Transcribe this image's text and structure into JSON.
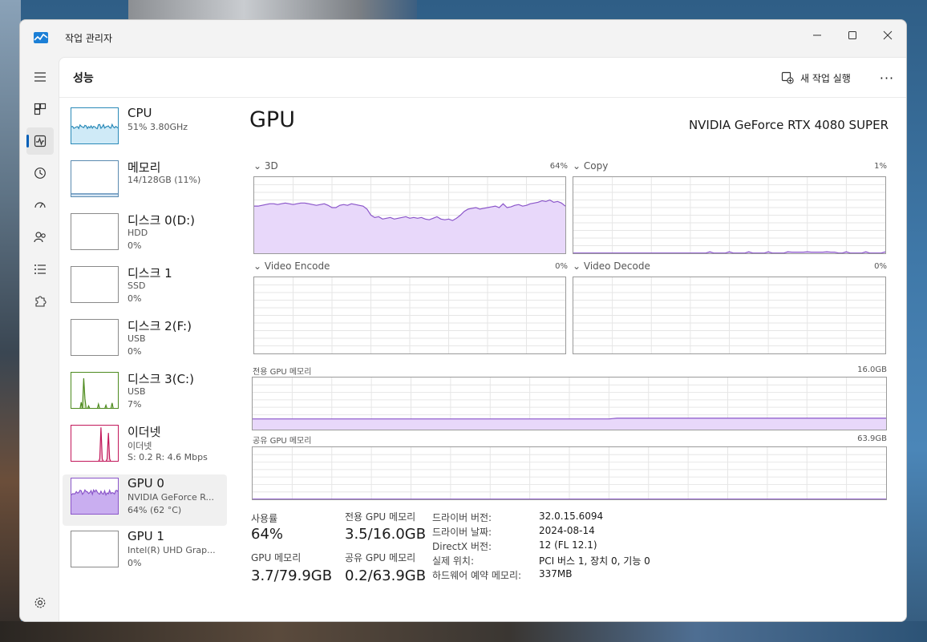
{
  "window": {
    "title": "작업 관리자"
  },
  "header": {
    "title": "성능",
    "new_task_label": "새 작업 실행",
    "more_label": "···"
  },
  "devices": [
    {
      "name": "CPU",
      "sub1": "51% 3.80GHz",
      "sub2": ""
    },
    {
      "name": "메모리",
      "sub1": "14/128GB (11%)",
      "sub2": ""
    },
    {
      "name": "디스크 0(D:)",
      "sub1": "HDD",
      "sub2": "0%"
    },
    {
      "name": "디스크 1",
      "sub1": "SSD",
      "sub2": "0%"
    },
    {
      "name": "디스크 2(F:)",
      "sub1": "USB",
      "sub2": "0%"
    },
    {
      "name": "디스크 3(C:)",
      "sub1": "USB",
      "sub2": "7%"
    },
    {
      "name": "이더넷",
      "sub1": "이더넷",
      "sub2": "S: 0.2  R: 4.6 Mbps"
    },
    {
      "name": "GPU 0",
      "sub1": "NVIDIA GeForce R...",
      "sub2": "64% (62 °C)"
    },
    {
      "name": "GPU 1",
      "sub1": "Intel(R) UHD Grap...",
      "sub2": "0%"
    }
  ],
  "gpu": {
    "title": "GPU",
    "model": "NVIDIA GeForce RTX 4080 SUPER",
    "engines": [
      {
        "label": "3D",
        "value": "64%"
      },
      {
        "label": "Copy",
        "value": "1%"
      },
      {
        "label": "Video Encode",
        "value": "0%"
      },
      {
        "label": "Video Decode",
        "value": "0%"
      }
    ],
    "dedicated_label": "전용 GPU 메모리",
    "dedicated_max": "16.0GB",
    "shared_label": "공유 GPU 메모리",
    "shared_max": "63.9GB"
  },
  "stats": {
    "usage_label": "사용률",
    "usage_value": "64%",
    "dedicated_label": "전용 GPU 메모리",
    "dedicated_value": "3.5/16.0GB",
    "gpu_mem_label": "GPU 메모리",
    "gpu_mem_value": "3.7/79.9GB",
    "shared_label": "공유 GPU 메모리",
    "shared_value": "0.2/63.9GB"
  },
  "props": [
    {
      "label": "드라이버 버전:",
      "value": "32.0.15.6094"
    },
    {
      "label": "드라이버 날짜:",
      "value": "2024-08-14"
    },
    {
      "label": "DirectX 버전:",
      "value": "12 (FL 12.1)"
    },
    {
      "label": "실제 위치:",
      "value": "PCI 버스 1, 장치 0, 기능 0"
    },
    {
      "label": "하드웨어 예약 메모리:",
      "value": "337MB"
    }
  ],
  "colors": {
    "gpu_line": "#8a55c9",
    "gpu_fill": "#e8d8fa",
    "cpu_line": "#2a8ab8",
    "cpu_fill": "#cfeaf7",
    "disk_line": "#4d8a1e",
    "net_line": "#c2185b",
    "accent": "#005fb8"
  }
}
